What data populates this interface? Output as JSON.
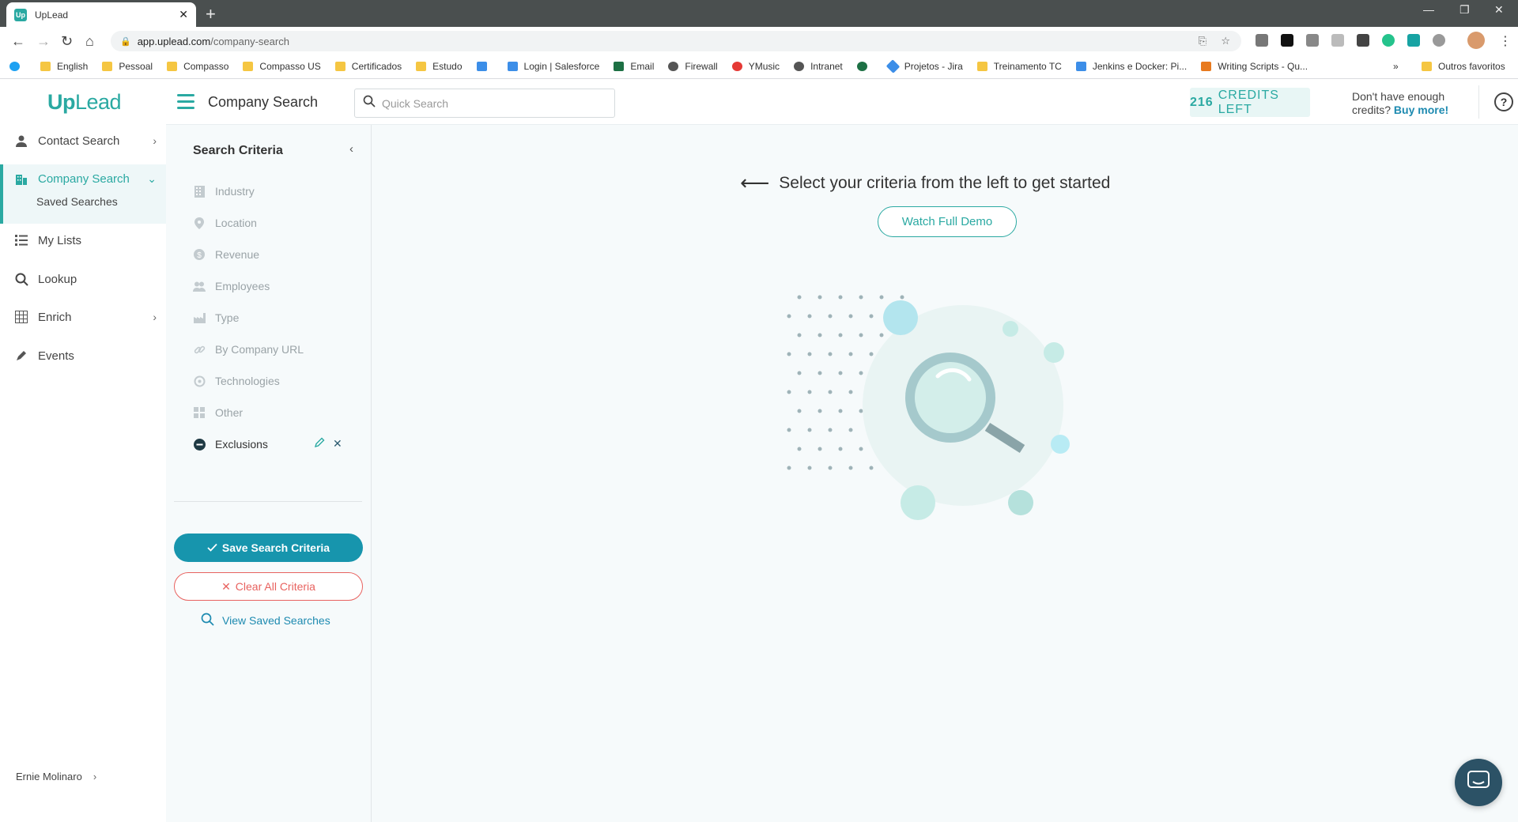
{
  "browser": {
    "tab_title": "UpLead",
    "tab_favicon_text": "Up",
    "url_host": "app.uplead.com",
    "url_path": "/company-search",
    "bookmarks": [
      "English",
      "Pessoal",
      "Compasso",
      "Compasso US",
      "Certificados",
      "Estudo",
      "Login | Salesforce",
      "Email",
      "Firewall",
      "YMusic",
      "Intranet",
      "Projetos - Jira",
      "Treinamento TC",
      "Jenkins e Docker: Pi...",
      "Writing Scripts - Qu..."
    ],
    "bookmarks_overflow": "»",
    "other_bookmarks": "Outros favoritos"
  },
  "sidebar": {
    "logo_up": "Up",
    "logo_lead": "Lead",
    "items": [
      {
        "label": "Contact Search",
        "icon": "user-icon"
      },
      {
        "label": "Company Search",
        "icon": "building-icon"
      },
      {
        "label": "My Lists",
        "icon": "list-icon"
      },
      {
        "label": "Lookup",
        "icon": "search-icon"
      },
      {
        "label": "Enrich",
        "icon": "table-icon"
      },
      {
        "label": "Events",
        "icon": "pen-icon"
      }
    ],
    "sub_item": "Saved Searches",
    "user_name": "Ernie Molinaro"
  },
  "header": {
    "title": "Company Search",
    "search_placeholder": "Quick Search",
    "credits_count": "216",
    "credits_label": "CREDITS LEFT",
    "not_enough_line1": "Don't have enough",
    "not_enough_line2": "credits?",
    "buy_more": "Buy more",
    "buy_more_suffix": "!",
    "help": "?"
  },
  "criteria": {
    "title": "Search Criteria",
    "items": [
      {
        "label": "Industry",
        "icon": "building-icon"
      },
      {
        "label": "Location",
        "icon": "pin-icon"
      },
      {
        "label": "Revenue",
        "icon": "dollar-icon"
      },
      {
        "label": "Employees",
        "icon": "people-icon"
      },
      {
        "label": "Type",
        "icon": "factory-icon"
      },
      {
        "label": "By Company URL",
        "icon": "link-icon"
      },
      {
        "label": "Technologies",
        "icon": "gear-icon"
      },
      {
        "label": "Other",
        "icon": "grid-icon"
      },
      {
        "label": "Exclusions",
        "icon": "minus-circle-icon"
      }
    ],
    "save_button": "Save Search Criteria",
    "clear_button": "Clear All Criteria",
    "view_saved": "View Saved Searches"
  },
  "main": {
    "prompt": "Select your criteria from the left to get started",
    "demo_button": "Watch Full Demo"
  },
  "colors": {
    "accent": "#2aa9a2",
    "primary_button": "#1795ad",
    "danger": "#e8625f",
    "link": "#1d8ab0"
  }
}
